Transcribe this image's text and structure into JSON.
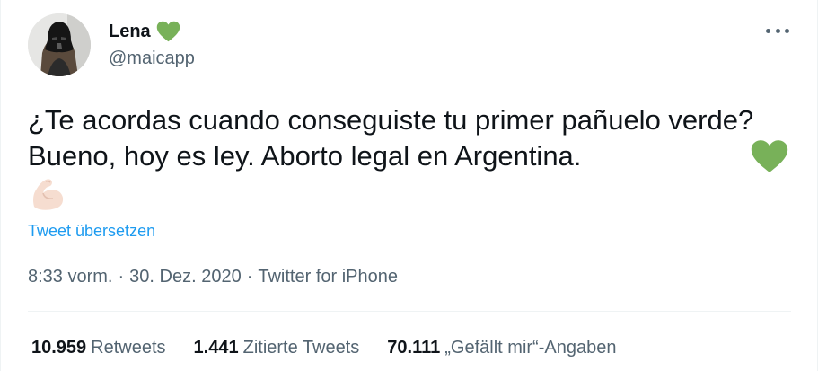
{
  "user": {
    "display_name": "Lena",
    "handle": "@maicapp"
  },
  "tweet": {
    "text": "¿Te acordas cuando conseguiste tu primer pañuelo verde? Bueno, hoy es ley. Aborto legal en Argentina.",
    "emojis": [
      "green-heart",
      "flexed-biceps"
    ],
    "translate_label": "Tweet übersetzen",
    "time": "8:33 vorm.",
    "date": "30. Dez. 2020",
    "separator": "·",
    "source": "Twitter for iPhone"
  },
  "stats": [
    {
      "count": "10.959",
      "label": "Retweets"
    },
    {
      "count": "1.441",
      "label": "Zitierte Tweets"
    },
    {
      "count": "70.111",
      "label": "„Gefällt mir“-Angaben"
    }
  ],
  "colors": {
    "accent": "#1d9bf0",
    "heart_green": "#78b159",
    "secondary_text": "#536471"
  }
}
